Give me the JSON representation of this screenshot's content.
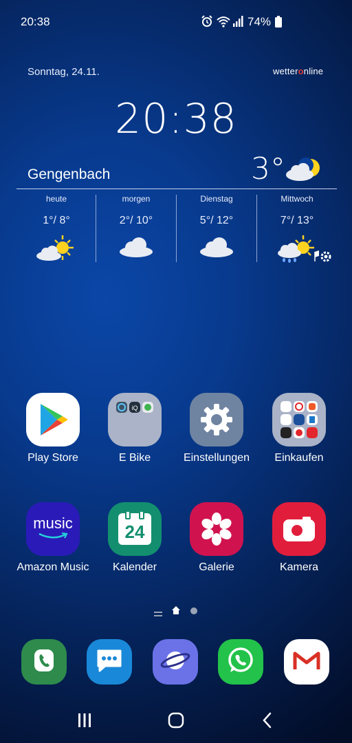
{
  "status_bar": {
    "time": "20:38",
    "battery": "74%",
    "icons": [
      "alarm-icon",
      "wifi-icon",
      "signal-icon",
      "battery-icon"
    ]
  },
  "weather_widget": {
    "date": "Sonntag, 24.11.",
    "brand": "wetteronline",
    "time": "20:38",
    "city": "Gengenbach",
    "current_temp": "3°",
    "current_icon": "cloud-moon-icon",
    "forecast": [
      {
        "day": "heute",
        "range": "1°/ 8°",
        "icon": "sun-cloud-icon"
      },
      {
        "day": "morgen",
        "range": "2°/ 10°",
        "icon": "cloud-icon"
      },
      {
        "day": "Dienstag",
        "range": "5°/ 12°",
        "icon": "cloud-icon"
      },
      {
        "day": "Mittwoch",
        "range": "7°/ 13°",
        "icon": "rain-sun-cloud-icon"
      }
    ]
  },
  "apps_row1": [
    {
      "label": "Play Store",
      "icon": "play-store-icon"
    },
    {
      "label": "E Bike",
      "icon": "folder-icon"
    },
    {
      "label": "Einstellungen",
      "icon": "settings-gear-icon"
    },
    {
      "label": "Einkaufen",
      "icon": "folder-icon"
    }
  ],
  "apps_row2": [
    {
      "label": "Amazon Music",
      "icon": "amazon-music-icon",
      "icon_text": "music"
    },
    {
      "label": "Kalender",
      "icon": "calendar-icon",
      "icon_text": "24"
    },
    {
      "label": "Galerie",
      "icon": "flower-icon"
    },
    {
      "label": "Kamera",
      "icon": "camera-icon"
    }
  ],
  "dock": [
    "phone-icon",
    "messages-icon",
    "internet-browser-icon",
    "whatsapp-icon",
    "gmail-icon"
  ],
  "nav_bar": [
    "recent-apps-icon",
    "home-icon",
    "back-icon"
  ],
  "colors": {
    "play_store_bg": "#ffffff",
    "settings_bg": "#6f84a1",
    "amazon_music_bg": "#2a1bb8",
    "calendar_bg": "#138f6f",
    "gallery_bg": "#d0134f",
    "camera_bg": "#e11d3c",
    "phone_bg": "#2e8b4c",
    "messages_bg": "#1a88d8",
    "browser_bg": "#6b72e8",
    "whatsapp_bg": "#23c24a",
    "gmail_bg": "#ffffff"
  }
}
